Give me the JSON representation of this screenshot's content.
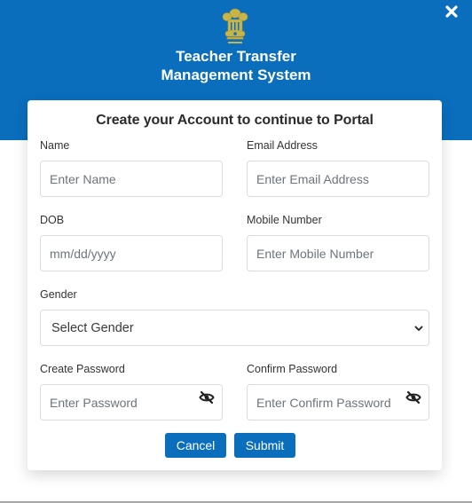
{
  "header": {
    "title_line1": "Teacher Transfer",
    "title_line2": "Management System",
    "emblem_icon": "national-emblem-icon",
    "close_icon": "close-icon",
    "brand_color": "#0a6ebd"
  },
  "form": {
    "title": "Create your Account to continue to Portal",
    "fields": {
      "name": {
        "label": "Name",
        "placeholder": "Enter Name",
        "value": ""
      },
      "email": {
        "label": "Email Address",
        "placeholder": "Enter Email Address",
        "value": ""
      },
      "dob": {
        "label": "DOB",
        "placeholder": "mm/dd/yyyy",
        "value": ""
      },
      "mobile": {
        "label": "Mobile Number",
        "placeholder": "Enter Mobile Number",
        "value": ""
      },
      "gender": {
        "label": "Gender",
        "selected": "Select Gender"
      },
      "password": {
        "label": "Create Password",
        "placeholder": "Enter Password",
        "value": "",
        "toggle_icon": "eye-slash-icon"
      },
      "confirm_password": {
        "label": "Confirm Password",
        "placeholder": "Enter Confirm Password",
        "value": "",
        "toggle_icon": "eye-slash-icon"
      }
    },
    "buttons": {
      "cancel": "Cancel",
      "submit": "Submit"
    }
  }
}
